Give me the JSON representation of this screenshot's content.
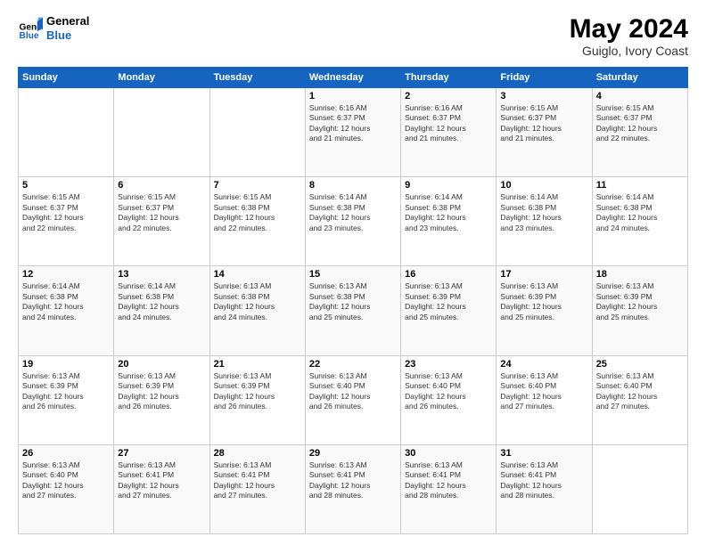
{
  "logo": {
    "line1": "General",
    "line2": "Blue"
  },
  "title": "May 2024",
  "subtitle": "Guiglo, Ivory Coast",
  "weekdays": [
    "Sunday",
    "Monday",
    "Tuesday",
    "Wednesday",
    "Thursday",
    "Friday",
    "Saturday"
  ],
  "weeks": [
    [
      {
        "day": "",
        "info": ""
      },
      {
        "day": "",
        "info": ""
      },
      {
        "day": "",
        "info": ""
      },
      {
        "day": "1",
        "info": "Sunrise: 6:16 AM\nSunset: 6:37 PM\nDaylight: 12 hours\nand 21 minutes."
      },
      {
        "day": "2",
        "info": "Sunrise: 6:16 AM\nSunset: 6:37 PM\nDaylight: 12 hours\nand 21 minutes."
      },
      {
        "day": "3",
        "info": "Sunrise: 6:15 AM\nSunset: 6:37 PM\nDaylight: 12 hours\nand 21 minutes."
      },
      {
        "day": "4",
        "info": "Sunrise: 6:15 AM\nSunset: 6:37 PM\nDaylight: 12 hours\nand 22 minutes."
      }
    ],
    [
      {
        "day": "5",
        "info": "Sunrise: 6:15 AM\nSunset: 6:37 PM\nDaylight: 12 hours\nand 22 minutes."
      },
      {
        "day": "6",
        "info": "Sunrise: 6:15 AM\nSunset: 6:37 PM\nDaylight: 12 hours\nand 22 minutes."
      },
      {
        "day": "7",
        "info": "Sunrise: 6:15 AM\nSunset: 6:38 PM\nDaylight: 12 hours\nand 22 minutes."
      },
      {
        "day": "8",
        "info": "Sunrise: 6:14 AM\nSunset: 6:38 PM\nDaylight: 12 hours\nand 23 minutes."
      },
      {
        "day": "9",
        "info": "Sunrise: 6:14 AM\nSunset: 6:38 PM\nDaylight: 12 hours\nand 23 minutes."
      },
      {
        "day": "10",
        "info": "Sunrise: 6:14 AM\nSunset: 6:38 PM\nDaylight: 12 hours\nand 23 minutes."
      },
      {
        "day": "11",
        "info": "Sunrise: 6:14 AM\nSunset: 6:38 PM\nDaylight: 12 hours\nand 24 minutes."
      }
    ],
    [
      {
        "day": "12",
        "info": "Sunrise: 6:14 AM\nSunset: 6:38 PM\nDaylight: 12 hours\nand 24 minutes."
      },
      {
        "day": "13",
        "info": "Sunrise: 6:14 AM\nSunset: 6:38 PM\nDaylight: 12 hours\nand 24 minutes."
      },
      {
        "day": "14",
        "info": "Sunrise: 6:13 AM\nSunset: 6:38 PM\nDaylight: 12 hours\nand 24 minutes."
      },
      {
        "day": "15",
        "info": "Sunrise: 6:13 AM\nSunset: 6:38 PM\nDaylight: 12 hours\nand 25 minutes."
      },
      {
        "day": "16",
        "info": "Sunrise: 6:13 AM\nSunset: 6:39 PM\nDaylight: 12 hours\nand 25 minutes."
      },
      {
        "day": "17",
        "info": "Sunrise: 6:13 AM\nSunset: 6:39 PM\nDaylight: 12 hours\nand 25 minutes."
      },
      {
        "day": "18",
        "info": "Sunrise: 6:13 AM\nSunset: 6:39 PM\nDaylight: 12 hours\nand 25 minutes."
      }
    ],
    [
      {
        "day": "19",
        "info": "Sunrise: 6:13 AM\nSunset: 6:39 PM\nDaylight: 12 hours\nand 26 minutes."
      },
      {
        "day": "20",
        "info": "Sunrise: 6:13 AM\nSunset: 6:39 PM\nDaylight: 12 hours\nand 26 minutes."
      },
      {
        "day": "21",
        "info": "Sunrise: 6:13 AM\nSunset: 6:39 PM\nDaylight: 12 hours\nand 26 minutes."
      },
      {
        "day": "22",
        "info": "Sunrise: 6:13 AM\nSunset: 6:40 PM\nDaylight: 12 hours\nand 26 minutes."
      },
      {
        "day": "23",
        "info": "Sunrise: 6:13 AM\nSunset: 6:40 PM\nDaylight: 12 hours\nand 26 minutes."
      },
      {
        "day": "24",
        "info": "Sunrise: 6:13 AM\nSunset: 6:40 PM\nDaylight: 12 hours\nand 27 minutes."
      },
      {
        "day": "25",
        "info": "Sunrise: 6:13 AM\nSunset: 6:40 PM\nDaylight: 12 hours\nand 27 minutes."
      }
    ],
    [
      {
        "day": "26",
        "info": "Sunrise: 6:13 AM\nSunset: 6:40 PM\nDaylight: 12 hours\nand 27 minutes."
      },
      {
        "day": "27",
        "info": "Sunrise: 6:13 AM\nSunset: 6:41 PM\nDaylight: 12 hours\nand 27 minutes."
      },
      {
        "day": "28",
        "info": "Sunrise: 6:13 AM\nSunset: 6:41 PM\nDaylight: 12 hours\nand 27 minutes."
      },
      {
        "day": "29",
        "info": "Sunrise: 6:13 AM\nSunset: 6:41 PM\nDaylight: 12 hours\nand 28 minutes."
      },
      {
        "day": "30",
        "info": "Sunrise: 6:13 AM\nSunset: 6:41 PM\nDaylight: 12 hours\nand 28 minutes."
      },
      {
        "day": "31",
        "info": "Sunrise: 6:13 AM\nSunset: 6:41 PM\nDaylight: 12 hours\nand 28 minutes."
      },
      {
        "day": "",
        "info": ""
      }
    ]
  ]
}
